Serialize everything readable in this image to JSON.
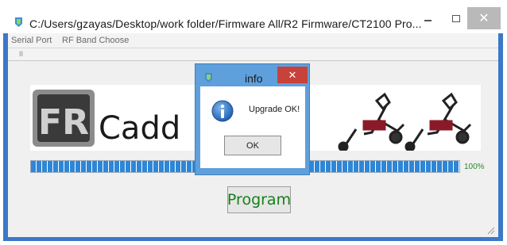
{
  "window": {
    "title": "C:/Users/gzayas/Desktop/work folder/Firmware All/R2 Firmware/CT2100  Pro...",
    "close_glyph": "✕"
  },
  "menu": {
    "items": [
      {
        "label": "Serial Port"
      },
      {
        "label": "RF Band Choose"
      }
    ]
  },
  "toolbar": {
    "grip_glyph": "II"
  },
  "banner": {
    "logo_text": "Cadd",
    "logo_mark": "FR"
  },
  "progress": {
    "value": 1.0,
    "label": "100%"
  },
  "program_button": {
    "label": "Program"
  },
  "dialog": {
    "title": "info",
    "close_glyph": "✕",
    "message": "Upgrade OK!",
    "ok_label": "OK"
  },
  "colors": {
    "window_frame": "#3b78c8",
    "dialog_frame": "#5fa0dc",
    "dialog_close": "#c7423a",
    "progress_fill": "#2e86d6",
    "program_text": "#15801a"
  },
  "icons": {
    "app": "app-icon",
    "info": "info-icon",
    "resize": "resize-grip-icon"
  }
}
